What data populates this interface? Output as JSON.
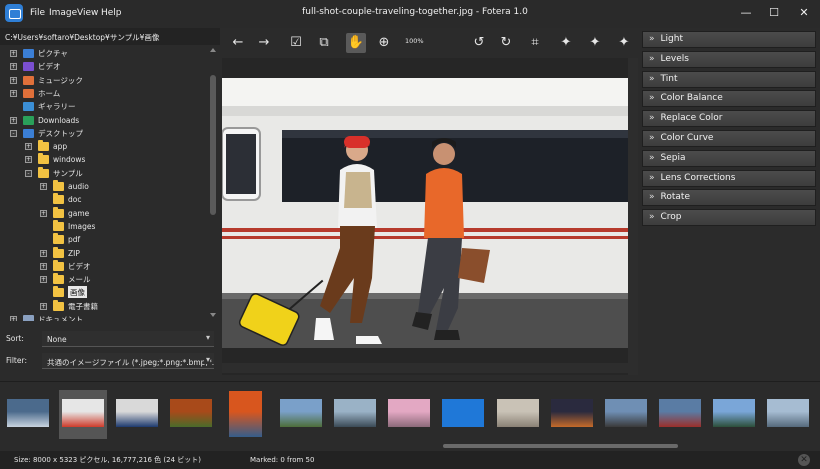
{
  "window": {
    "title": "full-shot-couple-traveling-together.jpg - Fotera 1.0",
    "menu": [
      "File",
      "Image",
      "View",
      "Help"
    ],
    "controls": {
      "minimize": "—",
      "maximize": "☐",
      "close": "✕"
    }
  },
  "left_panel": {
    "path": "C:¥Users¥softaro¥Desktop¥サンプル¥画像",
    "tree": [
      {
        "label": "ピクチャ",
        "expander": "+",
        "icon": "pictures-icon"
      },
      {
        "label": "ビデオ",
        "expander": "+",
        "icon": "video-icon"
      },
      {
        "label": "ミュージック",
        "expander": "+",
        "icon": "music-icon"
      },
      {
        "label": "ホーム",
        "expander": "+",
        "icon": "home-icon"
      },
      {
        "label": "ギャラリー",
        "expander": "",
        "icon": "gallery-icon"
      },
      {
        "label": "Downloads",
        "expander": "+",
        "icon": "download-icon"
      },
      {
        "label": "デスクトップ",
        "expander": "-",
        "icon": "desktop-icon"
      },
      {
        "label": "app",
        "expander": "+",
        "icon": "folder-icon"
      },
      {
        "label": "windows",
        "expander": "+",
        "icon": "folder-icon"
      },
      {
        "label": "サンプル",
        "expander": "-",
        "icon": "folder-icon"
      },
      {
        "label": "audio",
        "expander": "+",
        "icon": "folder-icon"
      },
      {
        "label": "doc",
        "expander": "",
        "icon": "folder-icon"
      },
      {
        "label": "game",
        "expander": "+",
        "icon": "folder-icon"
      },
      {
        "label": "Images",
        "expander": "",
        "icon": "folder-icon"
      },
      {
        "label": "pdf",
        "expander": "",
        "icon": "folder-icon"
      },
      {
        "label": "ZIP",
        "expander": "+",
        "icon": "folder-icon"
      },
      {
        "label": "ビデオ",
        "expander": "+",
        "icon": "folder-icon"
      },
      {
        "label": "メール",
        "expander": "+",
        "icon": "folder-icon"
      },
      {
        "label": "画像",
        "expander": "",
        "icon": "folder-icon",
        "selected": true
      },
      {
        "label": "電子書籍",
        "expander": "+",
        "icon": "folder-icon"
      },
      {
        "label": "ドキュメント",
        "expander": "+",
        "icon": "documents-icon"
      }
    ],
    "sort": {
      "label": "Sort:",
      "value": "None"
    },
    "filter": {
      "label": "Filter:",
      "value": "共通のイメージファイル (*.jpeg;*.png;*.bmp;*.ti"
    }
  },
  "toolbar": {
    "buttons": [
      {
        "name": "back-arrow-icon",
        "glyph": "←"
      },
      {
        "name": "forward-arrow-icon",
        "glyph": "→"
      },
      {
        "name": "check-icon",
        "glyph": "☑"
      },
      {
        "name": "check-all-icon",
        "glyph": "⧉"
      },
      {
        "name": "hand-pan-icon",
        "glyph": "✋",
        "active": true
      },
      {
        "name": "zoom-icon",
        "glyph": "⊕"
      },
      {
        "name": "rotate-left-icon",
        "glyph": "↺"
      },
      {
        "name": "rotate-right-icon",
        "glyph": "↻"
      },
      {
        "name": "crop-icon",
        "glyph": "⌗"
      },
      {
        "name": "magic-wand-1-icon",
        "glyph": "✦"
      },
      {
        "name": "magic-wand-2-icon",
        "glyph": "✦"
      },
      {
        "name": "magic-wand-3-icon",
        "glyph": "✦"
      }
    ],
    "zoom": "100%"
  },
  "adjustments": [
    "Light",
    "Levels",
    "Tint",
    "Color Balance",
    "Replace Color",
    "Color Curve",
    "Sepia",
    "Lens Corrections",
    "Rotate",
    "Crop"
  ],
  "adjust_chevron": "»",
  "thumbnails": [
    {
      "name": "thumb-skyline",
      "colors": [
        "#4b6a8c",
        "#c9d4df"
      ]
    },
    {
      "name": "thumb-couple-train",
      "colors": [
        "#e6e6e6",
        "#cf3b2b"
      ],
      "selected": true
    },
    {
      "name": "thumb-man-portrait",
      "colors": [
        "#d9d9d9",
        "#1e3a6e"
      ]
    },
    {
      "name": "thumb-autumn-tree",
      "colors": [
        "#a84a1a",
        "#4a6b2a"
      ]
    },
    {
      "name": "thumb-maple",
      "colors": [
        "#d8561e",
        "#355d8a"
      ]
    },
    {
      "name": "thumb-landscape",
      "colors": [
        "#7aa0c9",
        "#4d6d3a"
      ]
    },
    {
      "name": "thumb-building",
      "colors": [
        "#9ab2c6",
        "#3b4a56"
      ]
    },
    {
      "name": "thumb-cherry-blossom",
      "colors": [
        "#e3a8c3",
        "#8c6a7a"
      ]
    },
    {
      "name": "thumb-blue",
      "colors": [
        "#1f78d8",
        "#1f78d8"
      ]
    },
    {
      "name": "thumb-sand",
      "colors": [
        "#c9c2b6",
        "#8a8175"
      ]
    },
    {
      "name": "thumb-sunset",
      "colors": [
        "#2a2a3e",
        "#c56a2a"
      ]
    },
    {
      "name": "thumb-street",
      "colors": [
        "#6f8fb4",
        "#3a3a3a"
      ]
    },
    {
      "name": "thumb-temple",
      "colors": [
        "#5a7ca4",
        "#9a2f2a"
      ]
    },
    {
      "name": "thumb-sign",
      "colors": [
        "#7aa6d8",
        "#2d4f3a"
      ]
    },
    {
      "name": "thumb-river",
      "colors": [
        "#a6bcd2",
        "#566a7c"
      ]
    }
  ],
  "status": {
    "size": "Size: 8000 x 5323 ピクセル, 16,777,216 色 (24 ビット)",
    "marked": "Marked: 0 from 50",
    "close": "✕"
  }
}
